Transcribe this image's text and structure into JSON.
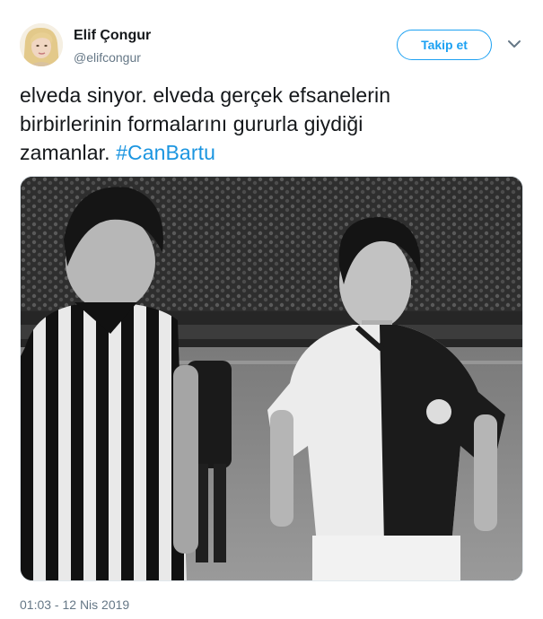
{
  "user": {
    "display_name": "Elif Çongur",
    "handle": "@elifcongur"
  },
  "follow_button": {
    "label": "Takip et"
  },
  "tweet": {
    "text_line1": "elveda sinyor. elveda gerçek efsanelerin",
    "text_line2": "birbirlerinin formalarını gururla giydiği",
    "text_line3_prefix": "zamanlar. ",
    "hashtag": "#CanBartu",
    "timestamp": "01:03 - 12 Nis 2019"
  },
  "colors": {
    "accent": "#1da1f2",
    "hashtag": "#1b95e0",
    "secondary_text": "#657786",
    "primary_text": "#14171a"
  },
  "icons": {
    "more": "chevron-down-icon"
  }
}
